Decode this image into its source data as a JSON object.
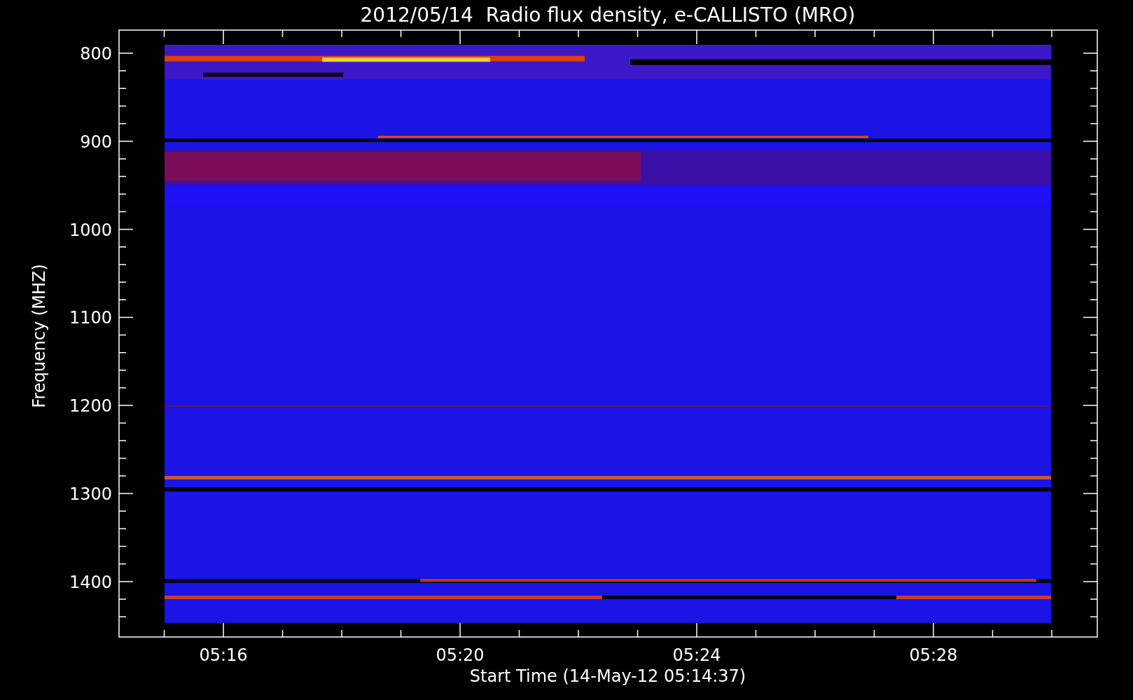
{
  "title": "2012/05/14  Radio flux density, e-CALLISTO (MRO)",
  "y_axis": {
    "label": "Frequency (MHZ)",
    "ticks": [
      "800",
      "900",
      "1000",
      "1100",
      "1200",
      "1300",
      "1400"
    ]
  },
  "x_axis": {
    "label": "Start Time (14-May-12 05:14:37)",
    "ticks": [
      "05:16",
      "05:20",
      "05:24",
      "05:28"
    ]
  }
}
